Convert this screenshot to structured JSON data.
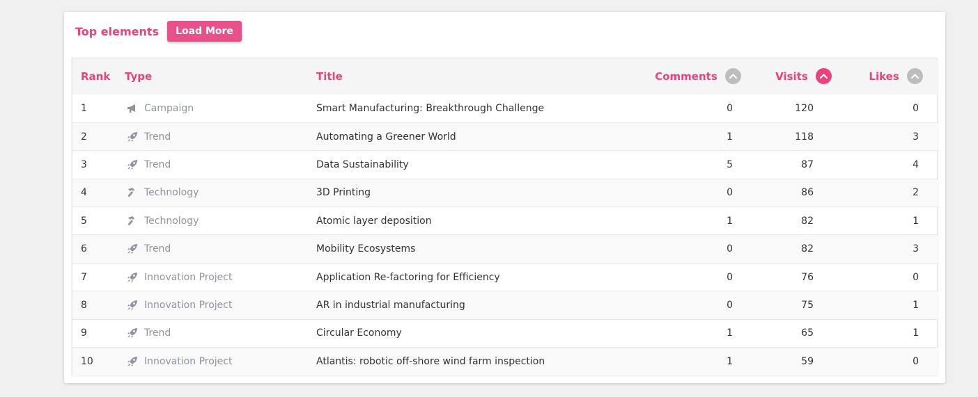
{
  "header": {
    "title": "Top elements",
    "load_more_label": "Load More"
  },
  "colors": {
    "accent": "#e8427f",
    "button": "#e8508a",
    "sort_inactive": "#bdbdbd",
    "type_text": "#8f93a3"
  },
  "columns": {
    "rank": "Rank",
    "type": "Type",
    "title": "Title",
    "comments": "Comments",
    "visits": "Visits",
    "likes": "Likes",
    "active_sort": "visits"
  },
  "rows": [
    {
      "rank": "1",
      "type": "Campaign",
      "icon": "megaphone-icon",
      "title": "Smart Manufacturing: Breakthrough Challenge",
      "comments": "0",
      "visits": "120",
      "likes": "0"
    },
    {
      "rank": "2",
      "type": "Trend",
      "icon": "rocket-icon",
      "title": "Automating a Greener World",
      "comments": "1",
      "visits": "118",
      "likes": "3"
    },
    {
      "rank": "3",
      "type": "Trend",
      "icon": "rocket-icon",
      "title": "Data Sustainability",
      "comments": "5",
      "visits": "87",
      "likes": "4"
    },
    {
      "rank": "4",
      "type": "Technology",
      "icon": "hammer-icon",
      "title": "3D Printing",
      "comments": "0",
      "visits": "86",
      "likes": "2"
    },
    {
      "rank": "5",
      "type": "Technology",
      "icon": "hammer-icon",
      "title": "Atomic layer deposition",
      "comments": "1",
      "visits": "82",
      "likes": "1"
    },
    {
      "rank": "6",
      "type": "Trend",
      "icon": "rocket-icon",
      "title": "Mobility Ecosystems",
      "comments": "0",
      "visits": "82",
      "likes": "3"
    },
    {
      "rank": "7",
      "type": "Innovation Project",
      "icon": "rocket-icon",
      "title": "Application Re-factoring for Efficiency",
      "comments": "0",
      "visits": "76",
      "likes": "0"
    },
    {
      "rank": "8",
      "type": "Innovation Project",
      "icon": "rocket-icon",
      "title": "AR in industrial manufacturing",
      "comments": "0",
      "visits": "75",
      "likes": "1"
    },
    {
      "rank": "9",
      "type": "Trend",
      "icon": "rocket-icon",
      "title": "Circular Economy",
      "comments": "1",
      "visits": "65",
      "likes": "1"
    },
    {
      "rank": "10",
      "type": "Innovation Project",
      "icon": "rocket-icon",
      "title": "Atlantis: robotic off-shore wind farm inspection",
      "comments": "1",
      "visits": "59",
      "likes": "0"
    }
  ]
}
